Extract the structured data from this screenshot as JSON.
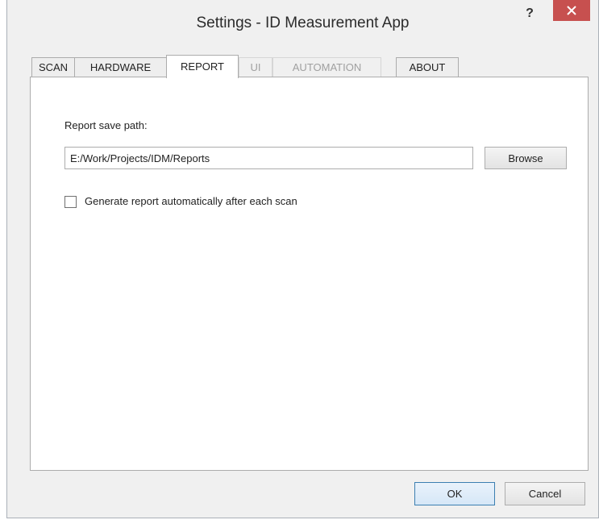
{
  "window": {
    "title": "Settings - ID Measurement App",
    "help_label": "?"
  },
  "tabs": [
    {
      "label": "SCAN",
      "state": "normal"
    },
    {
      "label": "HARDWARE",
      "state": "normal"
    },
    {
      "label": "REPORT",
      "state": "active"
    },
    {
      "label": "UI",
      "state": "disabled"
    },
    {
      "label": "AUTOMATION",
      "state": "disabled"
    },
    {
      "label": "ABOUT",
      "state": "normal"
    }
  ],
  "report": {
    "save_path_label": "Report save path:",
    "save_path_value": "E:/Work/Projects/IDM/Reports",
    "browse_label": "Browse",
    "auto_generate_label": "Generate report automatically after each scan",
    "auto_generate_checked": false
  },
  "footer": {
    "ok_label": "OK",
    "cancel_label": "Cancel"
  },
  "colors": {
    "close_button": "#c7504f",
    "window_background": "#f0f0f0",
    "disabled_text": "#a0a0a0"
  }
}
